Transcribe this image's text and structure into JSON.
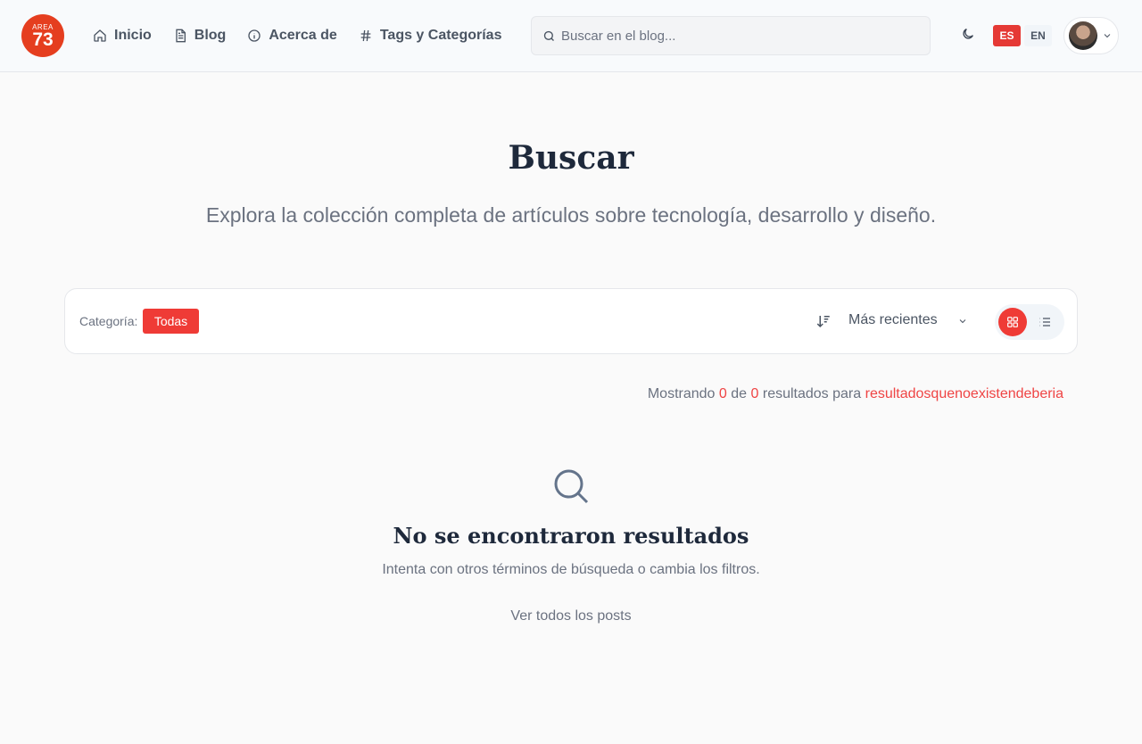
{
  "header": {
    "logo": {
      "top_text": "AREA",
      "number": "73"
    },
    "nav": [
      {
        "label": "Inicio",
        "icon": "home-icon"
      },
      {
        "label": "Blog",
        "icon": "document-icon"
      },
      {
        "label": "Acerca de",
        "icon": "info-icon"
      },
      {
        "label": "Tags y Categorías",
        "icon": "hash-icon"
      }
    ],
    "search": {
      "placeholder": "Buscar en el blog..."
    },
    "theme_icon": "moon-icon",
    "languages": {
      "es": "ES",
      "en": "EN",
      "active": "ES"
    }
  },
  "main": {
    "title": "Buscar",
    "subtitle": "Explora la colección completa de artículos sobre tecnología, desarrollo y diseño.",
    "filters": {
      "category_label": "Categoría:",
      "category_selected": "Todas",
      "sort_selected": "Más recientes",
      "view_mode": "grid"
    },
    "results": {
      "prefix": "Mostrando",
      "shown": "0",
      "of": "de",
      "total": "0",
      "suffix": "resultados para",
      "query": "resultadosquenoexistendeberia"
    },
    "empty_state": {
      "icon": "search-icon",
      "title": "No se encontraron resultados",
      "description": "Intenta con otros términos de búsqueda o cambia los filtros.",
      "link": "Ver todos los posts"
    }
  },
  "colors": {
    "accent": "#ef3b36",
    "logo": "#e53e1f"
  }
}
